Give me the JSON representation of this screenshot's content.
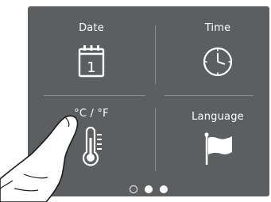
{
  "tiles": {
    "date": {
      "label": "Date",
      "icon": "calendar-icon",
      "calendar_day": "1"
    },
    "time": {
      "label": "Time",
      "icon": "clock-icon"
    },
    "units": {
      "label": "°C / °F",
      "icon": "thermometer-icon"
    },
    "language": {
      "label": "Language",
      "icon": "flag-icon"
    }
  },
  "pagination": {
    "page_count": 3,
    "current_page": 2
  },
  "colors": {
    "screen_background": "#5b5f62",
    "foreground": "#ffffff",
    "divider": "#8a8e91"
  }
}
